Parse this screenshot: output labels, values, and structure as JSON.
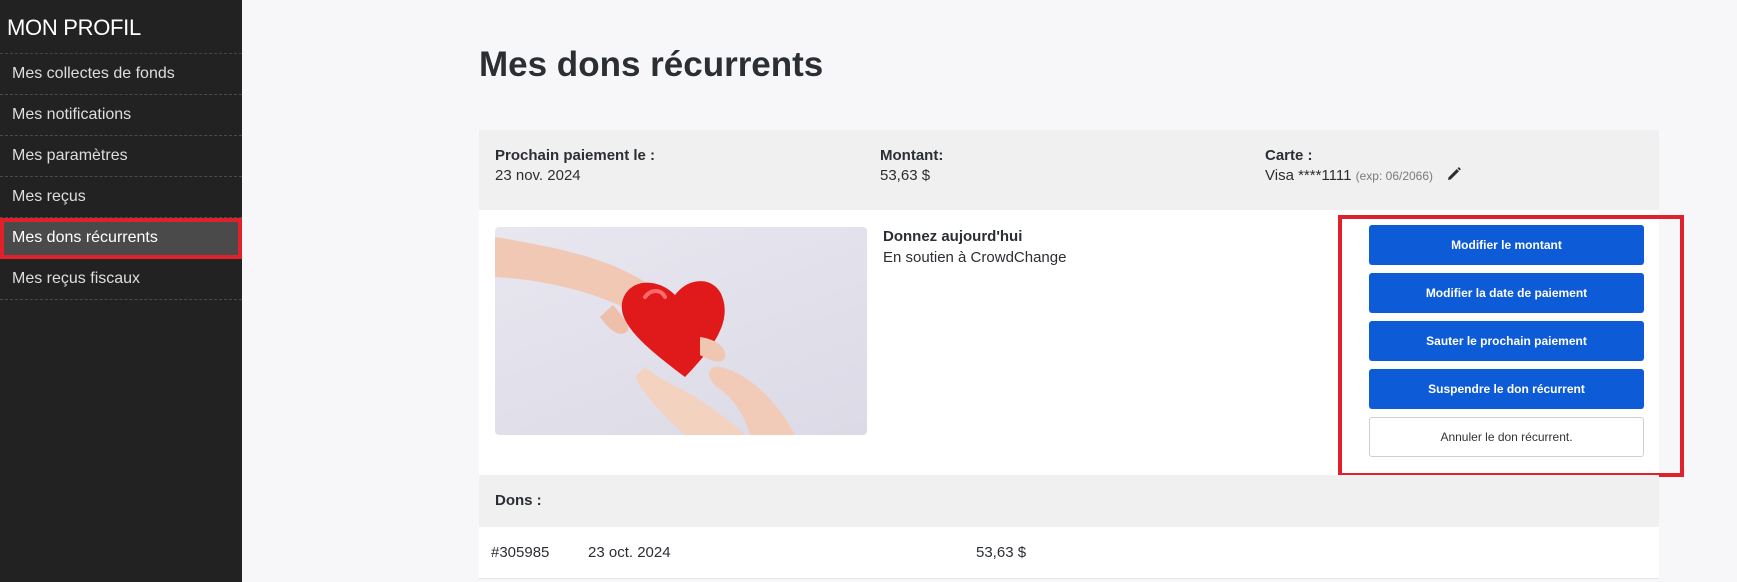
{
  "sidebar": {
    "title": "MON PROFIL",
    "items": [
      {
        "label": "Mes collectes de fonds"
      },
      {
        "label": "Mes notifications"
      },
      {
        "label": "Mes paramètres"
      },
      {
        "label": "Mes reçus"
      },
      {
        "label": "Mes dons récurrents",
        "active": true
      },
      {
        "label": "Mes reçus fiscaux"
      }
    ]
  },
  "page": {
    "title": "Mes dons récurrents"
  },
  "summary": {
    "next_payment_label": "Prochain paiement le :",
    "next_payment_value": "23 nov. 2024",
    "amount_label": "Montant:",
    "amount_value": "53,63 $",
    "card_label": "Carte :",
    "card_value": "Visa ****1111",
    "card_exp": "(exp: 06/2066)",
    "edit_icon": "pencil-icon"
  },
  "campaign": {
    "title": "Donnez aujourd'hui",
    "subtitle": "En soutien à CrowdChange",
    "image": "hands-holding-red-heart"
  },
  "actions": {
    "modify_amount": "Modifier le montant",
    "modify_date": "Modifier la date de paiement",
    "skip_next": "Sauter le prochain paiement",
    "suspend": "Suspendre le don récurrent",
    "cancel": "Annuler le don récurrent."
  },
  "donations": {
    "header": "Dons :",
    "rows": [
      {
        "id": "#305985",
        "date": "23 oct. 2024",
        "amount": "53,63 $"
      }
    ]
  },
  "colors": {
    "sidebar_bg": "#222222",
    "primary_button": "#0d5bd6",
    "highlight": "#e0202a"
  }
}
